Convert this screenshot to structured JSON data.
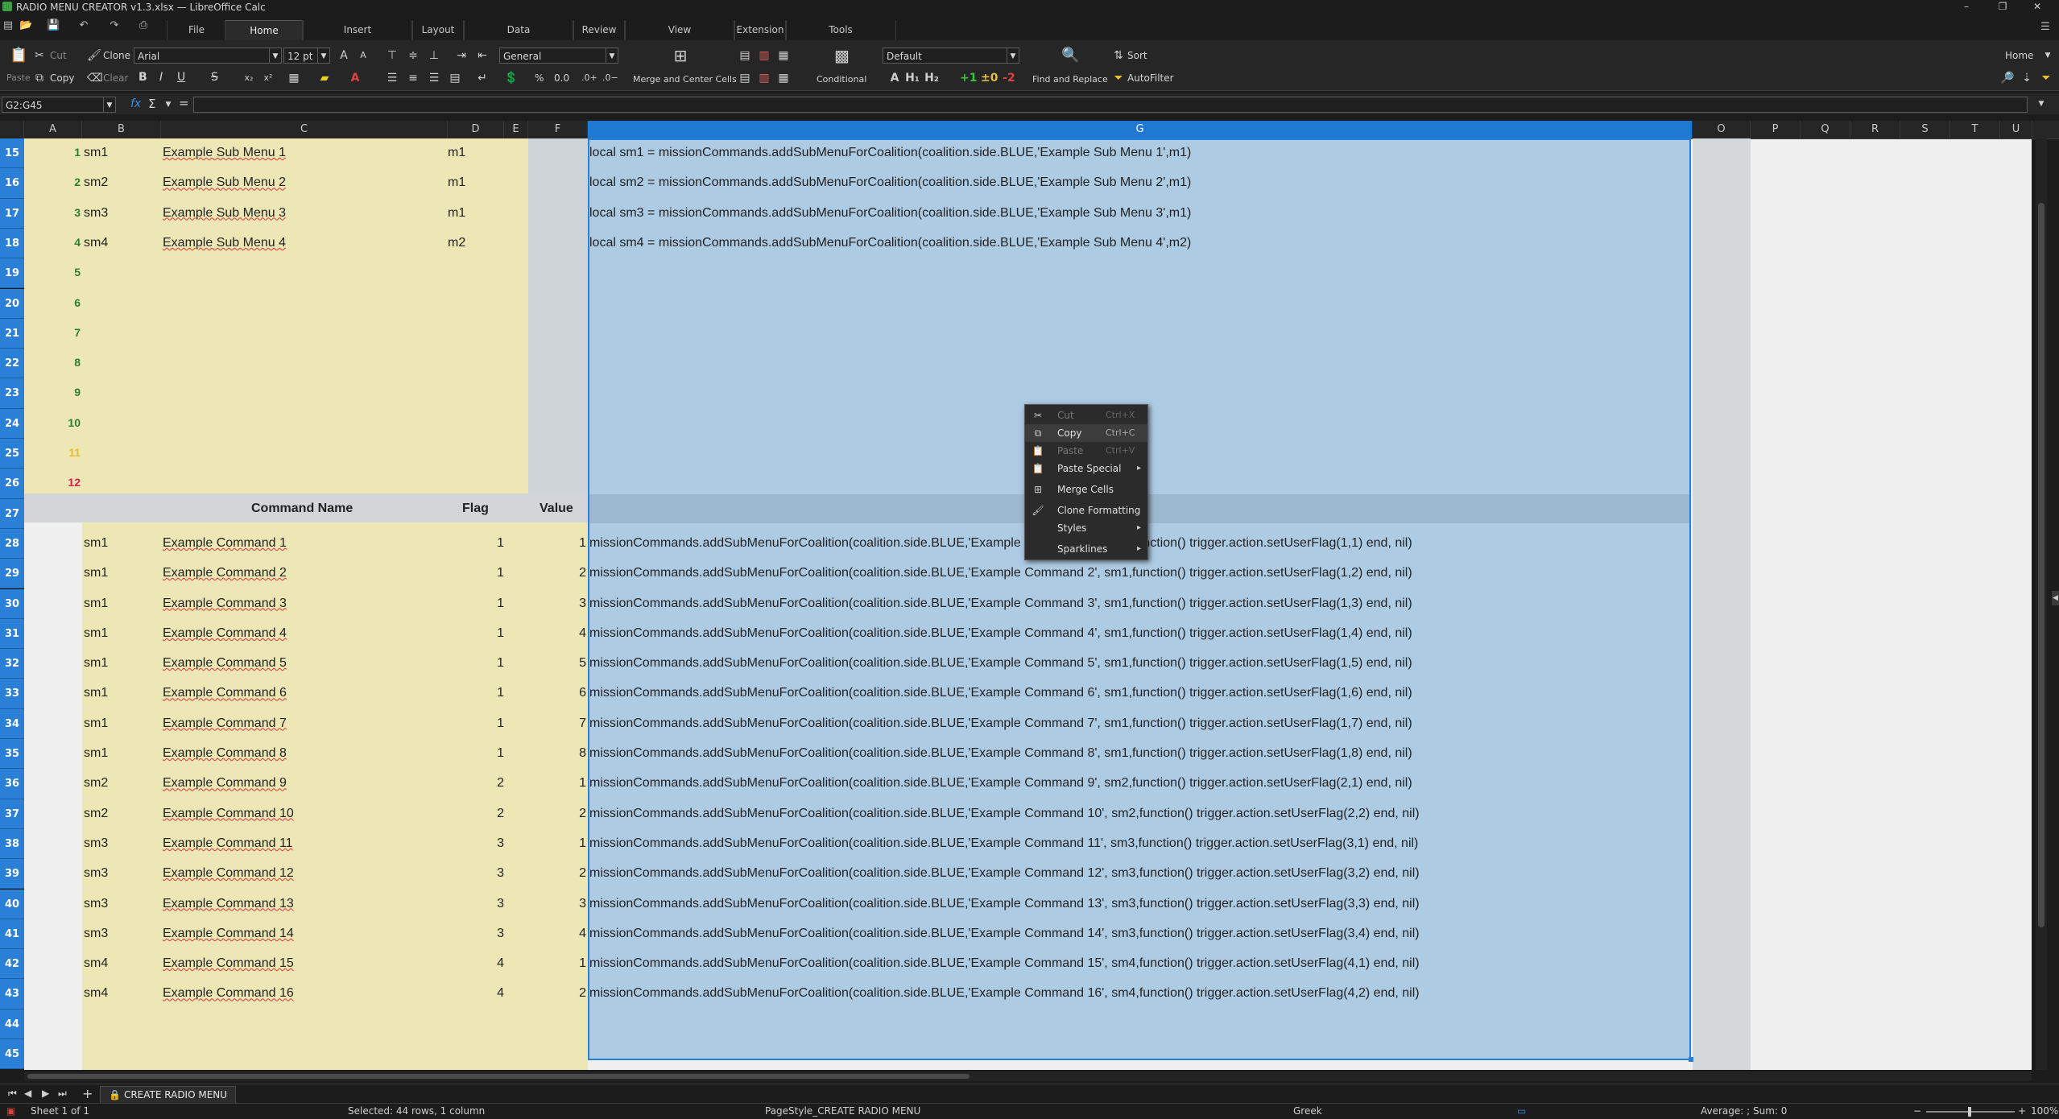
{
  "window": {
    "title": "RADIO MENU CREATOR v1.3.xlsx — LibreOffice Calc",
    "controls": [
      "–",
      "❐",
      "✕"
    ]
  },
  "menu_tabs": [
    "File",
    "Home",
    "Insert",
    "Layout",
    "Data",
    "Review",
    "View",
    "Extension",
    "Tools"
  ],
  "active_tab": "Home",
  "toolbar": {
    "cut": "Cut",
    "clone": "Clone",
    "paste": "Paste",
    "copy": "Copy",
    "clear": "Clear",
    "font_name": "Arial",
    "font_size": "12 pt",
    "bold": "B",
    "italic": "I",
    "underline": "U",
    "strike": "S",
    "number_format": "General",
    "percent": "%",
    "decimals": "0.0",
    "merge": "Merge and Center Cells",
    "conditional": "Conditional",
    "style": "Default",
    "find_replace": "Find and Replace",
    "sort": "Sort",
    "autofilter": "AutoFilter",
    "home_dropdown": "Home"
  },
  "formula_bar": {
    "name_box": "G2:G45",
    "fx": "fx",
    "sigma": "Σ",
    "equals": "="
  },
  "columns": [
    "A",
    "B",
    "C",
    "D",
    "E",
    "F",
    "G",
    "O",
    "P",
    "Q",
    "R",
    "S",
    "T",
    "U"
  ],
  "row_numbers": [
    "15",
    "16",
    "17",
    "18",
    "19",
    "20",
    "21",
    "22",
    "23",
    "24",
    "25",
    "26",
    "27",
    "28",
    "29",
    "30",
    "31",
    "32",
    "33",
    "34",
    "35",
    "36",
    "37",
    "38",
    "39",
    "40",
    "41",
    "42",
    "43",
    "44",
    "45"
  ],
  "colors": {
    "cell_fill": "#ede7b5",
    "selection_fill": "#aecbe4",
    "selection_border": "#2a7fd6",
    "header_band": "#c8d4dd",
    "gray_fill": "#cfd4d8",
    "app_dark": "#1c1c1c"
  },
  "submenus": [
    {
      "idx": "1",
      "name": "sm1",
      "label": "Example Sub Menu 1",
      "parent": "m1",
      "code": "local sm1 = missionCommands.addSubMenuForCoalition(coalition.side.BLUE,'Example Sub Menu 1',m1)"
    },
    {
      "idx": "2",
      "name": "sm2",
      "label": "Example Sub Menu 2",
      "parent": "m1",
      "code": "local sm2 = missionCommands.addSubMenuForCoalition(coalition.side.BLUE,'Example Sub Menu 2',m1)"
    },
    {
      "idx": "3",
      "name": "sm3",
      "label": "Example Sub Menu 3",
      "parent": "m1",
      "code": "local sm3 = missionCommands.addSubMenuForCoalition(coalition.side.BLUE,'Example Sub Menu 3',m1)"
    },
    {
      "idx": "4",
      "name": "sm4",
      "label": "Example Sub Menu 4",
      "parent": "m2",
      "code": "local sm4 = missionCommands.addSubMenuForCoalition(coalition.side.BLUE,'Example Sub Menu 4',m2)"
    }
  ],
  "empty_indices": [
    {
      "idx": "5",
      "color": "#2e7d32"
    },
    {
      "idx": "6",
      "color": "#2e7d32"
    },
    {
      "idx": "7",
      "color": "#2e7d32"
    },
    {
      "idx": "8",
      "color": "#2e7d32"
    },
    {
      "idx": "9",
      "color": "#2e7d32"
    },
    {
      "idx": "10",
      "color": "#2e7d32"
    },
    {
      "idx": "11",
      "color": "#e0c030"
    },
    {
      "idx": "12",
      "color": "#d0204a"
    }
  ],
  "command_headers": {
    "name": "Command Name",
    "flag": "Flag",
    "value": "Value"
  },
  "commands": [
    {
      "sub": "sm1",
      "name": "Example Command 1",
      "flag": "1",
      "value": "1",
      "code": "missionCommands.addSubMenuForCoalition(coalition.side.BLUE,'Example Command 1', sm1,function() trigger.action.setUserFlag(1,1) end, nil)"
    },
    {
      "sub": "sm1",
      "name": "Example Command 2",
      "flag": "1",
      "value": "2",
      "code": "missionCommands.addSubMenuForCoalition(coalition.side.BLUE,'Example Command 2', sm1,function() trigger.action.setUserFlag(1,2) end, nil)"
    },
    {
      "sub": "sm1",
      "name": "Example Command 3",
      "flag": "1",
      "value": "3",
      "code": "missionCommands.addSubMenuForCoalition(coalition.side.BLUE,'Example Command 3', sm1,function() trigger.action.setUserFlag(1,3) end, nil)"
    },
    {
      "sub": "sm1",
      "name": "Example Command 4",
      "flag": "1",
      "value": "4",
      "code": "missionCommands.addSubMenuForCoalition(coalition.side.BLUE,'Example Command 4', sm1,function() trigger.action.setUserFlag(1,4) end, nil)"
    },
    {
      "sub": "sm1",
      "name": "Example Command 5",
      "flag": "1",
      "value": "5",
      "code": "missionCommands.addSubMenuForCoalition(coalition.side.BLUE,'Example Command 5', sm1,function() trigger.action.setUserFlag(1,5) end, nil)"
    },
    {
      "sub": "sm1",
      "name": "Example Command 6",
      "flag": "1",
      "value": "6",
      "code": "missionCommands.addSubMenuForCoalition(coalition.side.BLUE,'Example Command 6', sm1,function() trigger.action.setUserFlag(1,6) end, nil)"
    },
    {
      "sub": "sm1",
      "name": "Example Command 7",
      "flag": "1",
      "value": "7",
      "code": "missionCommands.addSubMenuForCoalition(coalition.side.BLUE,'Example Command 7', sm1,function() trigger.action.setUserFlag(1,7) end, nil)"
    },
    {
      "sub": "sm1",
      "name": "Example Command 8",
      "flag": "1",
      "value": "8",
      "code": "missionCommands.addSubMenuForCoalition(coalition.side.BLUE,'Example Command 8', sm1,function() trigger.action.setUserFlag(1,8) end, nil)"
    },
    {
      "sub": "sm2",
      "name": "Example Command 9",
      "flag": "2",
      "value": "1",
      "code": "missionCommands.addSubMenuForCoalition(coalition.side.BLUE,'Example Command 9', sm2,function() trigger.action.setUserFlag(2,1) end, nil)"
    },
    {
      "sub": "sm2",
      "name": "Example Command 10",
      "flag": "2",
      "value": "2",
      "code": "missionCommands.addSubMenuForCoalition(coalition.side.BLUE,'Example Command 10', sm2,function() trigger.action.setUserFlag(2,2) end, nil)"
    },
    {
      "sub": "sm3",
      "name": "Example Command 11",
      "flag": "3",
      "value": "1",
      "code": "missionCommands.addSubMenuForCoalition(coalition.side.BLUE,'Example Command 11', sm3,function() trigger.action.setUserFlag(3,1) end, nil)"
    },
    {
      "sub": "sm3",
      "name": "Example Command 12",
      "flag": "3",
      "value": "2",
      "code": "missionCommands.addSubMenuForCoalition(coalition.side.BLUE,'Example Command 12', sm3,function() trigger.action.setUserFlag(3,2) end, nil)"
    },
    {
      "sub": "sm3",
      "name": "Example Command 13",
      "flag": "3",
      "value": "3",
      "code": "missionCommands.addSubMenuForCoalition(coalition.side.BLUE,'Example Command 13', sm3,function() trigger.action.setUserFlag(3,3) end, nil)"
    },
    {
      "sub": "sm3",
      "name": "Example Command 14",
      "flag": "3",
      "value": "4",
      "code": "missionCommands.addSubMenuForCoalition(coalition.side.BLUE,'Example Command 14', sm3,function() trigger.action.setUserFlag(3,4) end, nil)"
    },
    {
      "sub": "sm4",
      "name": "Example Command 15",
      "flag": "4",
      "value": "1",
      "code": "missionCommands.addSubMenuForCoalition(coalition.side.BLUE,'Example Command 15', sm4,function() trigger.action.setUserFlag(4,1) end, nil)"
    },
    {
      "sub": "sm4",
      "name": "Example Command 16",
      "flag": "4",
      "value": "2",
      "code": "missionCommands.addSubMenuForCoalition(coalition.side.BLUE,'Example Command 16', sm4,function() trigger.action.setUserFlag(4,2) end, nil)"
    }
  ],
  "context_menu": [
    {
      "label": "Cut",
      "shortcut": "Ctrl+X",
      "icon": "cut-icon",
      "disabled": true
    },
    {
      "label": "Copy",
      "shortcut": "Ctrl+C",
      "icon": "copy-icon",
      "disabled": false
    },
    {
      "label": "Paste",
      "shortcut": "Ctrl+V",
      "icon": "paste-icon",
      "disabled": true
    },
    {
      "label": "Paste Special",
      "shortcut": "",
      "icon": "paste-special-icon",
      "disabled": false,
      "submenu": true
    },
    {
      "label": "Merge Cells",
      "shortcut": "",
      "icon": "merge-cells-icon",
      "disabled": false
    },
    {
      "label": "Clone Formatting",
      "shortcut": "",
      "icon": "clone-formatting-icon",
      "disabled": false
    },
    {
      "label": "Styles",
      "shortcut": "",
      "icon": "",
      "disabled": false,
      "submenu": true
    },
    {
      "label": "Sparklines",
      "shortcut": "",
      "icon": "",
      "disabled": false,
      "submenu": true
    }
  ],
  "sheet_tabs": {
    "active": "CREATE RADIO MENU"
  },
  "status": {
    "sheet": "Sheet 1 of 1",
    "selection": "Selected: 44 rows, 1 column",
    "page_style": "PageStyle_CREATE RADIO MENU",
    "language": "Greek",
    "sum": "Average: ; Sum: 0",
    "zoom": "100%"
  }
}
